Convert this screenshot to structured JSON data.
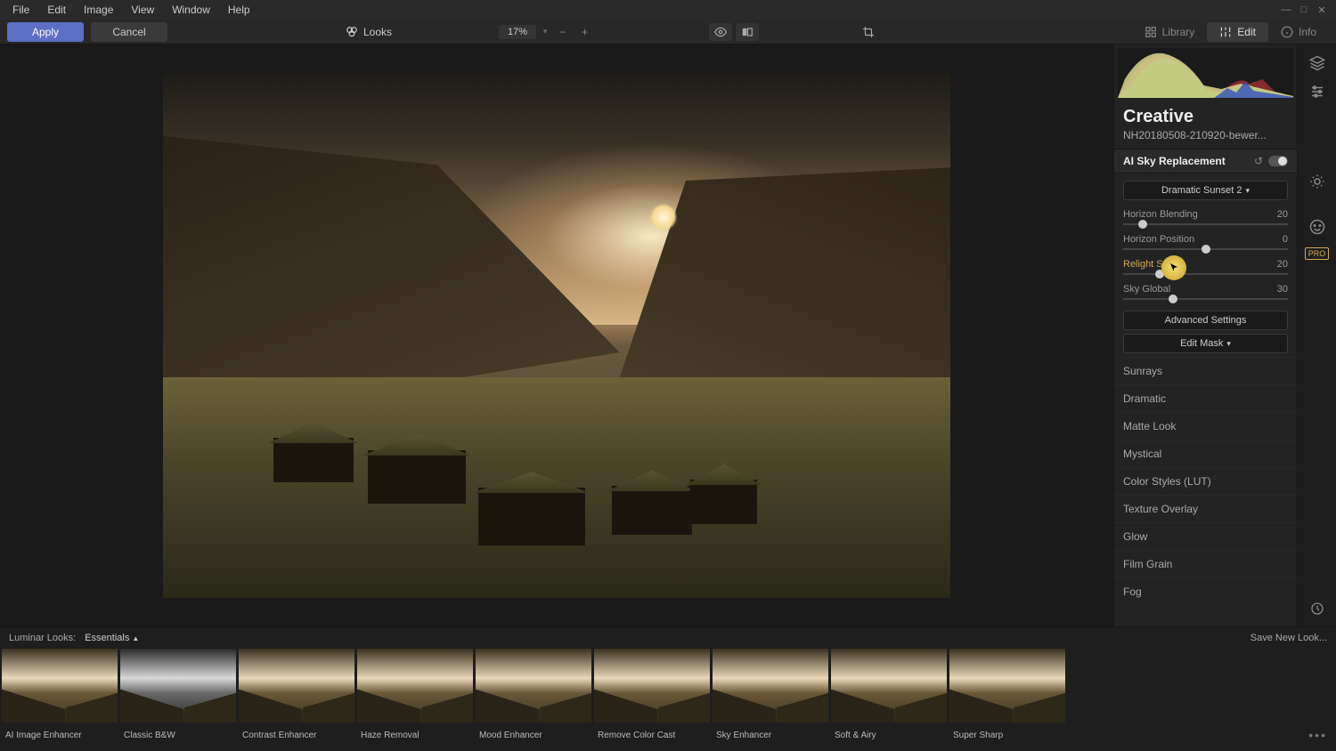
{
  "menu": [
    "File",
    "Edit",
    "Image",
    "View",
    "Window",
    "Help"
  ],
  "toolbar": {
    "apply": "Apply",
    "cancel": "Cancel",
    "looks": "Looks",
    "zoom": "17%",
    "library": "Library",
    "edit": "Edit",
    "info": "Info"
  },
  "panel": {
    "title": "Creative",
    "filename": "NH20180508-210920-bewer...",
    "tool": "AI Sky Replacement",
    "preset": "Dramatic Sunset 2",
    "sliders": [
      {
        "name": "Horizon Blending",
        "value": "20",
        "pos": 12
      },
      {
        "name": "Horizon Position",
        "value": "0",
        "pos": 50
      },
      {
        "name": "Relight Scene",
        "value": "20",
        "pos": 22,
        "hl": true
      },
      {
        "name": "Sky Global",
        "value": "30",
        "pos": 30
      }
    ],
    "advanced": "Advanced Settings",
    "editmask": "Edit Mask",
    "tools": [
      "Sunrays",
      "Dramatic",
      "Matte Look",
      "Mystical",
      "Color Styles (LUT)",
      "Texture Overlay",
      "Glow",
      "Film Grain",
      "Fog"
    ]
  },
  "filmstrip": {
    "header": "Luminar Looks:",
    "category": "Essentials",
    "save": "Save New Look...",
    "items": [
      "AI Image Enhancer",
      "Classic B&W",
      "Contrast Enhancer",
      "Haze Removal",
      "Mood Enhancer",
      "Remove Color Cast",
      "Sky Enhancer",
      "Soft & Airy",
      "Super Sharp"
    ]
  },
  "pro": "PRO"
}
